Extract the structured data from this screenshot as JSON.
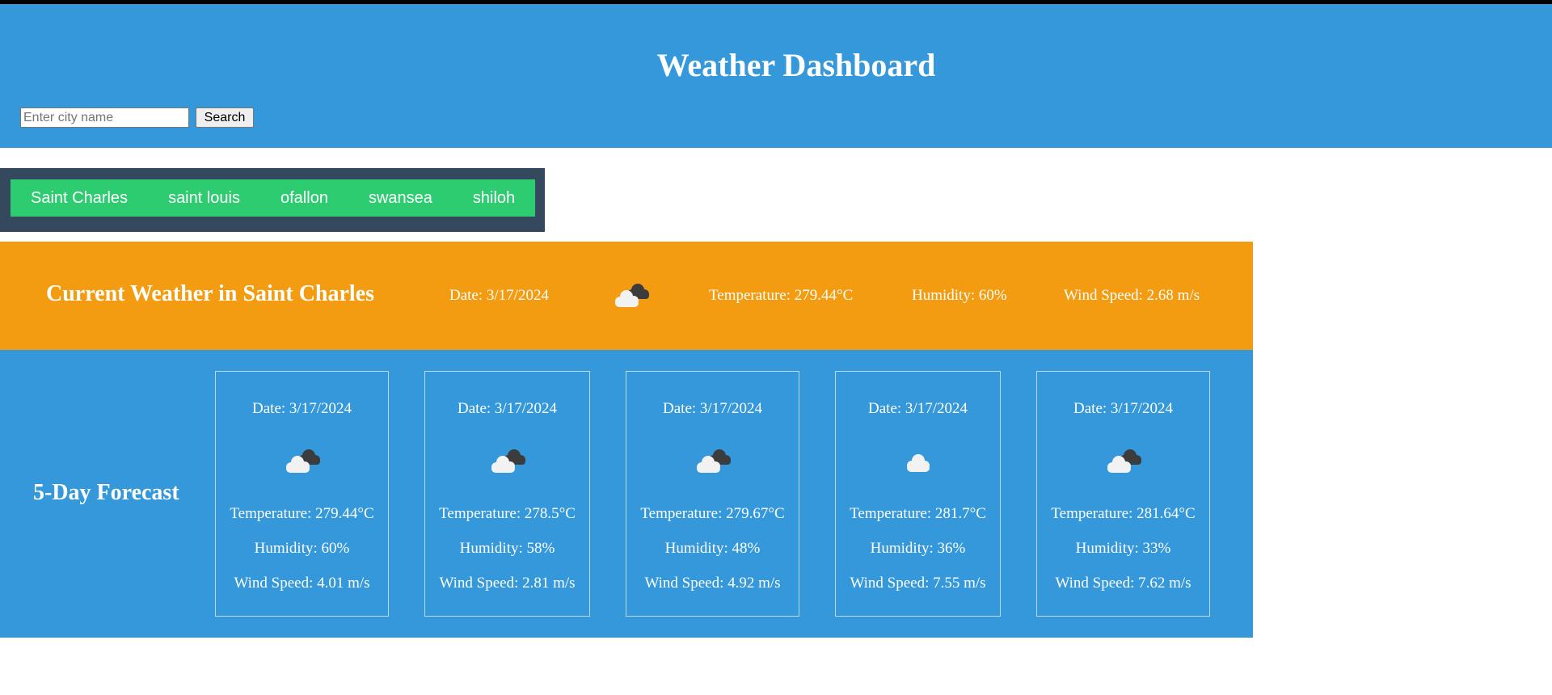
{
  "header": {
    "title": "Weather Dashboard",
    "search_placeholder": "Enter city name",
    "search_value": "",
    "search_button": "Search"
  },
  "history": [
    "Saint Charles",
    "saint louis",
    "ofallon",
    "swansea",
    "shiloh"
  ],
  "current": {
    "title": "Current Weather in Saint Charles",
    "date": "Date: 3/17/2024",
    "icon": "broken-clouds-icon",
    "temperature": "Temperature: 279.44°C",
    "humidity": "Humidity: 60%",
    "wind": "Wind Speed: 2.68 m/s"
  },
  "forecast": {
    "title": "5-Day Forecast",
    "days": [
      {
        "date": "Date: 3/17/2024",
        "icon": "broken-clouds-icon",
        "temperature": "Temperature: 279.44°C",
        "humidity": "Humidity: 60%",
        "wind": "Wind Speed: 4.01 m/s"
      },
      {
        "date": "Date: 3/17/2024",
        "icon": "broken-clouds-icon",
        "temperature": "Temperature: 278.5°C",
        "humidity": "Humidity: 58%",
        "wind": "Wind Speed: 2.81 m/s"
      },
      {
        "date": "Date: 3/17/2024",
        "icon": "broken-clouds-icon",
        "temperature": "Temperature: 279.67°C",
        "humidity": "Humidity: 48%",
        "wind": "Wind Speed: 4.92 m/s"
      },
      {
        "date": "Date: 3/17/2024",
        "icon": "cloud-icon",
        "temperature": "Temperature: 281.7°C",
        "humidity": "Humidity: 36%",
        "wind": "Wind Speed: 7.55 m/s"
      },
      {
        "date": "Date: 3/17/2024",
        "icon": "broken-clouds-icon",
        "temperature": "Temperature: 281.64°C",
        "humidity": "Humidity: 33%",
        "wind": "Wind Speed: 7.62 m/s"
      }
    ]
  }
}
